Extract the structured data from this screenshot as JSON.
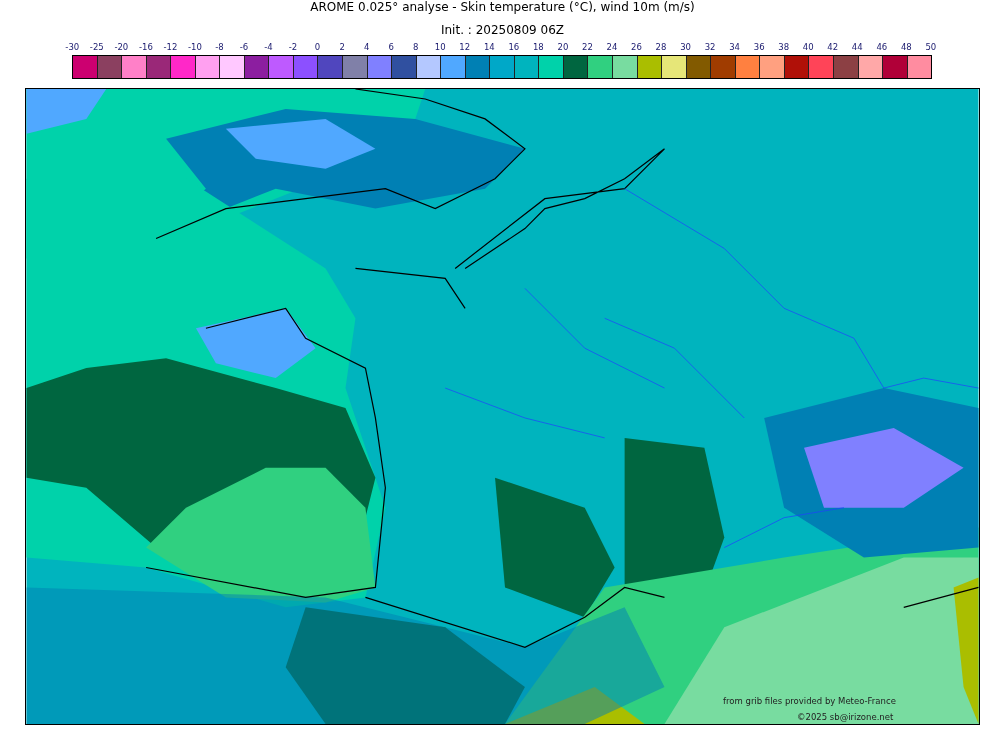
{
  "title": "AROME 0.025° analyse - Skin temperature (°C), wind 10m (m/s)",
  "subtitle": "Init. : 20250809 06Z",
  "colorbar": {
    "labels": [
      "-30",
      "-25",
      "-20",
      "-16",
      "-12",
      "-10",
      "-8",
      "-6",
      "-4",
      "-2",
      "0",
      "2",
      "4",
      "6",
      "8",
      "10",
      "12",
      "14",
      "16",
      "18",
      "20",
      "22",
      "24",
      "26",
      "28",
      "30",
      "32",
      "34",
      "36",
      "38",
      "40",
      "42",
      "44",
      "46",
      "48",
      "50"
    ],
    "bins": [
      {
        "color": "#cc0070"
      },
      {
        "color": "#8b4060"
      },
      {
        "color": "#ff80c8"
      },
      {
        "color": "#9a2878"
      },
      {
        "color": "#ff28c8"
      },
      {
        "color": "#ffa0f0"
      },
      {
        "color": "#ffc8ff"
      },
      {
        "color": "#8c1ea0"
      },
      {
        "color": "#be5aff"
      },
      {
        "color": "#8c50ff"
      },
      {
        "color": "#5046be"
      },
      {
        "color": "#8080a8"
      },
      {
        "color": "#8080ff"
      },
      {
        "color": "#3050a0"
      },
      {
        "color": "#b4c8ff"
      },
      {
        "color": "#50a8ff"
      },
      {
        "color": "#0080b4"
      },
      {
        "color": "#00a8c8"
      },
      {
        "color": "#00b4be"
      },
      {
        "color": "#00d2aa"
      },
      {
        "color": "#006640"
      },
      {
        "color": "#30d080"
      },
      {
        "color": "#78dca0"
      },
      {
        "color": "#aabe00"
      },
      {
        "color": "#e6e678"
      },
      {
        "color": "#825a00"
      },
      {
        "color": "#a03c00"
      },
      {
        "color": "#ff8040"
      },
      {
        "color": "#ffa080"
      },
      {
        "color": "#b01008"
      },
      {
        "color": "#ff4458"
      },
      {
        "color": "#8c4044"
      },
      {
        "color": "#ffa8a8"
      },
      {
        "color": "#b00038"
      },
      {
        "color": "#ff8ca0"
      }
    ]
  },
  "map": {
    "credits": [
      "from grib files provided by Meteo-France",
      "©2025 sb@irizone.net"
    ]
  }
}
